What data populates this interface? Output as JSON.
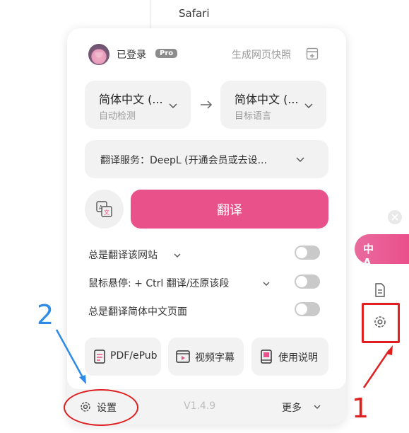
{
  "background": {
    "browser_label": "Safari"
  },
  "header": {
    "login_status": "已登录",
    "pro_badge": "Pro",
    "snapshot_label": "生成网页快照"
  },
  "languages": {
    "source": {
      "name": "简体中文 (...",
      "sub": "自动检测"
    },
    "target": {
      "name": "简体中文 (...",
      "sub": "目标语言"
    }
  },
  "service": {
    "label": "翻译服务：DeepL (开通会员或去设..."
  },
  "translate_button": "翻译",
  "options": [
    {
      "label": "总是翻译该网站",
      "enabled": false
    },
    {
      "label": "鼠标悬停:  + Ctrl 翻译/还原该段",
      "enabled": false
    },
    {
      "label": "总是翻译简体中文页面",
      "enabled": false
    }
  ],
  "features": [
    {
      "label": "PDF/ePub",
      "icon": "pdf-icon"
    },
    {
      "label": "视频字幕",
      "icon": "video-icon"
    },
    {
      "label": "使用说明",
      "icon": "book-icon"
    }
  ],
  "footer": {
    "settings_label": "设置",
    "version": "V1.4.9",
    "more_label": "更多"
  },
  "side_toolbar": {
    "translate_icon_text": "中A"
  },
  "annotations": {
    "one": "1",
    "two": "2"
  },
  "colors": {
    "accent": "#e8518a",
    "annotation_red": "#e02020",
    "annotation_blue": "#2d8ae6"
  }
}
